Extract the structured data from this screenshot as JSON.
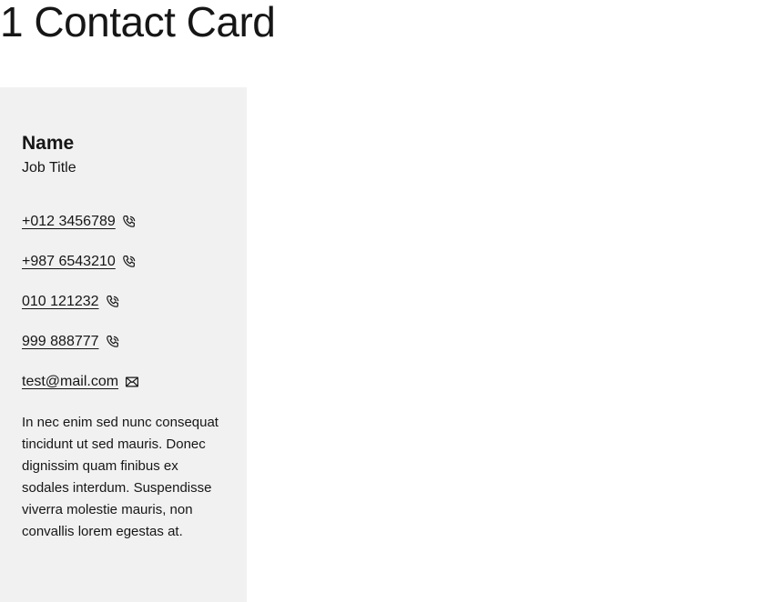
{
  "page": {
    "title": "1 Contact Card"
  },
  "card": {
    "name": "Name",
    "job_title": "Job Title",
    "contacts": [
      {
        "label": "+012 3456789",
        "icon": "phone-icon"
      },
      {
        "label": "+987 6543210",
        "icon": "phone-icon"
      },
      {
        "label": "010 121232",
        "icon": "phone-icon"
      },
      {
        "label": "999 888777",
        "icon": "phone-icon"
      },
      {
        "label": "test@mail.com",
        "icon": "mail-icon"
      }
    ],
    "description": "In nec enim sed nunc consequat tincidunt ut sed mauris. Donec dignissim quam finibus ex sodales interdum. Suspendisse viverra molestie mauris, non convallis lorem egestas at."
  }
}
